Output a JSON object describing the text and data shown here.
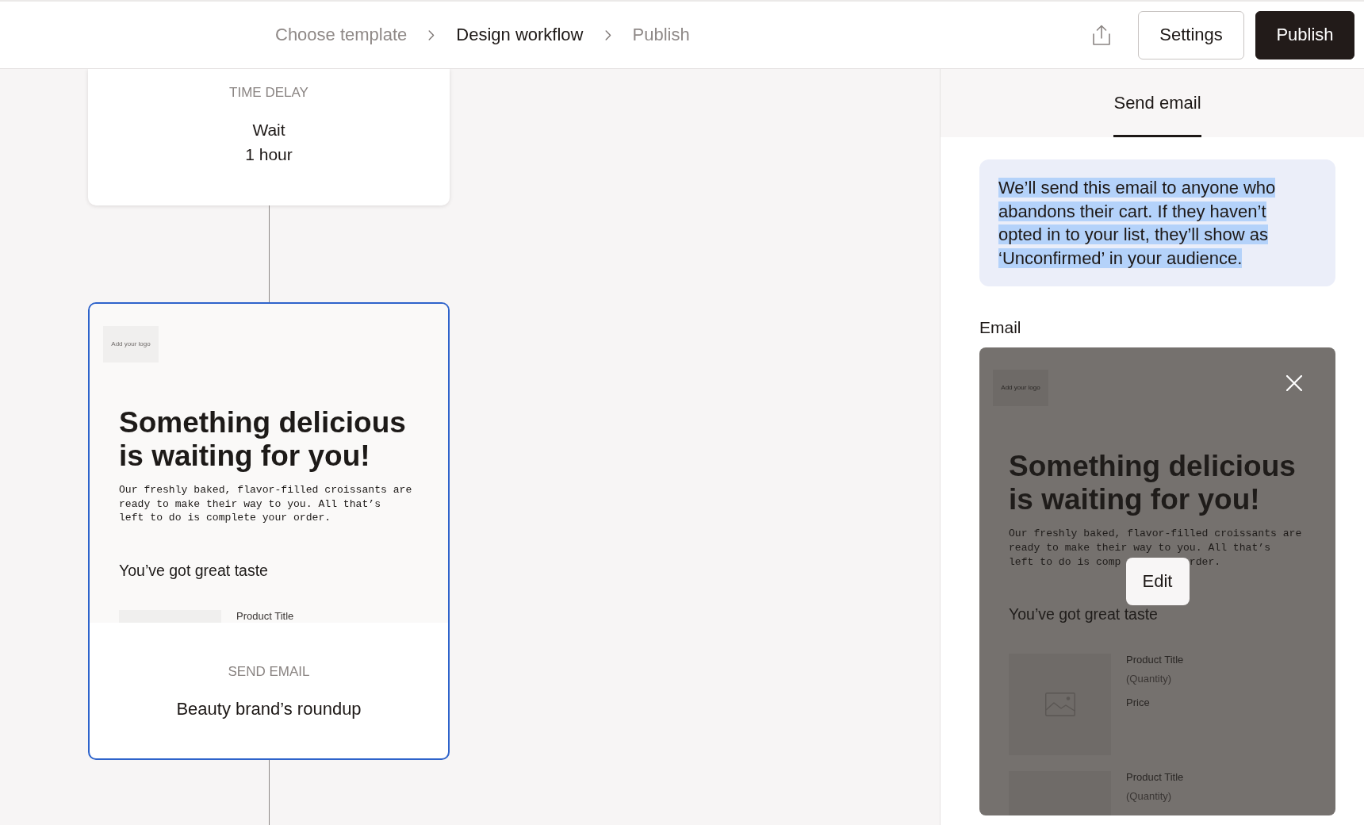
{
  "header": {
    "breadcrumbs": [
      {
        "label": "Choose template",
        "selected": false
      },
      {
        "label": "Design workflow",
        "selected": true
      },
      {
        "label": "Publish",
        "selected": false
      }
    ],
    "buttons": [
      {
        "kind": "settings",
        "label": "Settings"
      },
      {
        "kind": "publish",
        "label": "Publish"
      }
    ]
  },
  "canvas": {
    "nodes": [
      {
        "kind": "time_delay",
        "type_label": "TIME DELAY",
        "action": "Wait",
        "duration": "1 hour",
        "selected": false
      },
      {
        "kind": "send_email",
        "type_label": "SEND EMAIL",
        "name": "Beauty brand’s roundup",
        "selected": true,
        "preview": {
          "logo": "Add your logo",
          "headline": "Something delicious is waiting for you!",
          "body": "Our freshly baked, flavor-filled croissants are\nready to make their way to you. All that’s\nleft to do is complete your order.",
          "subheading": "You’ve got great taste",
          "products": [
            {
              "title": "Product Title"
            }
          ]
        }
      }
    ]
  },
  "panel": {
    "tabs": [
      {
        "label": "Send email",
        "selected": true
      }
    ],
    "info_note": {
      "text": "We’ll send this email to anyone who abandons their cart. If they haven’t opted in to your list, they’ll show as ‘Unconfirmed’ in your audience.",
      "highlighted": true
    },
    "email_label": "Email",
    "email_preview": {
      "hovered": true,
      "logo": "Add your logo",
      "headline": "Something delicious is waiting for you!",
      "body": "Our freshly baked, flavor-filled croissants are\nready to make their way to you. All that’s",
      "body_tail": [
        "left to do is comp",
        "rder."
      ],
      "subheading": "You’ve got great taste",
      "products": [
        {
          "title": "Product Title",
          "quantity": "(Quantity)",
          "price": "Price"
        },
        {
          "title": "Product Title",
          "quantity": "(Quantity)"
        }
      ],
      "edit_label": "Edit"
    }
  }
}
